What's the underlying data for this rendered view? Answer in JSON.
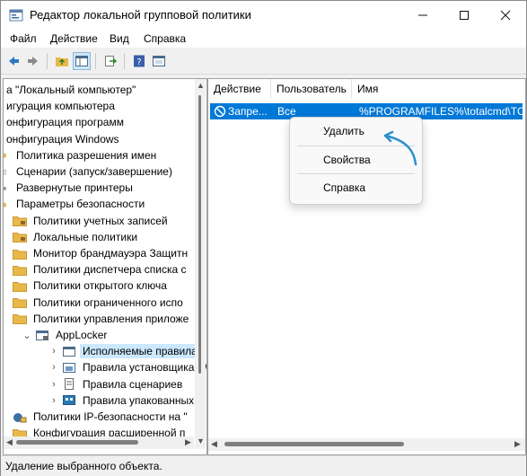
{
  "window": {
    "title": "Редактор локальной групповой политики"
  },
  "menu": [
    "Файл",
    "Действие",
    "Вид",
    "Справка"
  ],
  "tree": [
    {
      "label": "а \"Локальный компьютер\"",
      "depth": 0,
      "icon": "none"
    },
    {
      "label": "игурация компьютера",
      "depth": 0,
      "icon": "none"
    },
    {
      "label": "онфигурация программ",
      "depth": 0,
      "icon": "none"
    },
    {
      "label": "онфигурация Windows",
      "depth": 0,
      "icon": "none"
    },
    {
      "label": "Политика разрешения имен",
      "depth": 1,
      "icon": "folder-stub"
    },
    {
      "label": "Сценарии (запуск/завершение)",
      "depth": 1,
      "icon": "doc-stub"
    },
    {
      "label": "Развернутые принтеры",
      "depth": 1,
      "icon": "printer-stub"
    },
    {
      "label": "Параметры безопасности",
      "depth": 1,
      "icon": "folder-stub"
    },
    {
      "label": "Политики учетных записей",
      "depth": 2,
      "icon": "folder-lock"
    },
    {
      "label": "Локальные политики",
      "depth": 2,
      "icon": "folder-lock"
    },
    {
      "label": "Монитор брандмауэра Защитн",
      "depth": 2,
      "icon": "folder"
    },
    {
      "label": "Политики диспетчера списка с",
      "depth": 2,
      "icon": "folder"
    },
    {
      "label": "Политики открытого ключа",
      "depth": 2,
      "icon": "folder"
    },
    {
      "label": "Политики ограниченного испо",
      "depth": 2,
      "icon": "folder"
    },
    {
      "label": "Политики управления приложе",
      "depth": 2,
      "icon": "folder"
    },
    {
      "label": "AppLocker",
      "depth": 3,
      "icon": "applocker",
      "chevron": "down"
    },
    {
      "label": "Исполняемые правила",
      "depth": 4,
      "icon": "rules-exe",
      "chevron": "right",
      "selected": true
    },
    {
      "label": "Правила установщика W",
      "depth": 4,
      "icon": "rules-msi",
      "chevron": "right"
    },
    {
      "label": "Правила сценариев",
      "depth": 4,
      "icon": "rules-script",
      "chevron": "right"
    },
    {
      "label": "Правила упакованных п",
      "depth": 4,
      "icon": "rules-appx",
      "chevron": "right"
    },
    {
      "label": "Политики IP-безопасности на \"",
      "depth": 2,
      "icon": "ipsec",
      "chevron": ""
    },
    {
      "label": "Конфигурация расширенной п",
      "depth": 2,
      "icon": "folder",
      "chevron": ""
    }
  ],
  "list": {
    "columns": [
      "Действие",
      "Пользователь",
      "Имя"
    ],
    "rows": [
      {
        "action": "Запре...",
        "user": "Все",
        "name": "%PROGRAMFILES%\\totalcmd\\TCM",
        "selected": true,
        "icon": "deny-icon"
      }
    ]
  },
  "context_menu": {
    "items": [
      "Удалить",
      "Свойства",
      "Справка"
    ]
  },
  "status": {
    "text": "Удаление выбранного объекта."
  },
  "colors": {
    "selection": "#0078d7",
    "tree_selection": "#cce8ff",
    "arrow_annotation": "#2a8fd0",
    "folder": "#e8b84a"
  }
}
